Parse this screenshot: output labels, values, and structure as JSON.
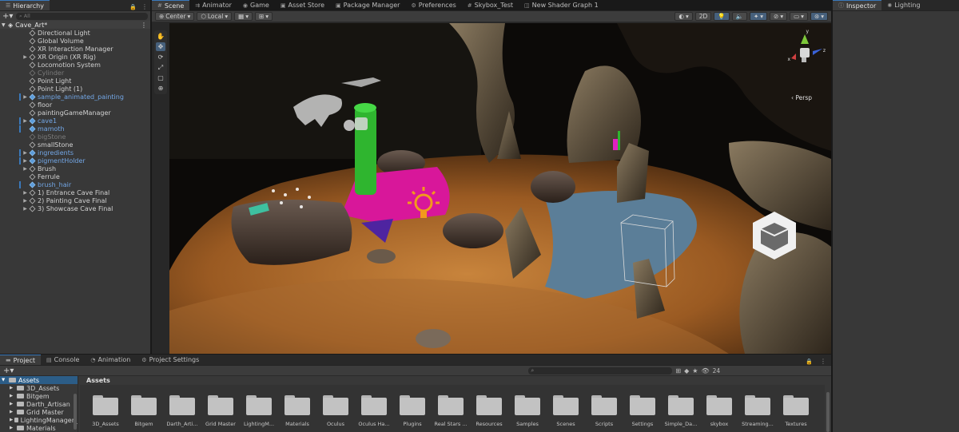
{
  "hierarchy": {
    "tab_label": "Hierarchy",
    "search_placeholder": "All",
    "scene_name": "Cave_Art*",
    "items": [
      {
        "label": "Directional Light",
        "indent": 1,
        "style": "normal",
        "arrow": false
      },
      {
        "label": "Global Volume",
        "indent": 1,
        "style": "normal",
        "arrow": false
      },
      {
        "label": "XR Interaction Manager",
        "indent": 1,
        "style": "normal",
        "arrow": false
      },
      {
        "label": "XR Origin (XR Rig)",
        "indent": 1,
        "style": "normal",
        "arrow": true
      },
      {
        "label": "Locomotion System",
        "indent": 1,
        "style": "normal",
        "arrow": false
      },
      {
        "label": "Cylinder",
        "indent": 1,
        "style": "gray",
        "arrow": false
      },
      {
        "label": "Point Light",
        "indent": 1,
        "style": "normal",
        "arrow": false
      },
      {
        "label": "Point Light (1)",
        "indent": 1,
        "style": "normal",
        "arrow": false
      },
      {
        "label": "sample_animated_painting",
        "indent": 1,
        "style": "blue",
        "arrow": true,
        "mark": true
      },
      {
        "label": "floor",
        "indent": 1,
        "style": "normal",
        "arrow": false
      },
      {
        "label": "paintingGameManager",
        "indent": 1,
        "style": "normal",
        "arrow": false
      },
      {
        "label": "cave1",
        "indent": 1,
        "style": "blue-dim",
        "arrow": true,
        "mark": true
      },
      {
        "label": "mamoth",
        "indent": 1,
        "style": "blue",
        "arrow": false,
        "mark": true
      },
      {
        "label": "bigStone",
        "indent": 1,
        "style": "gray",
        "arrow": false
      },
      {
        "label": "smallStone",
        "indent": 1,
        "style": "normal",
        "arrow": false
      },
      {
        "label": "ingredients",
        "indent": 1,
        "style": "blue",
        "arrow": true,
        "mark": true
      },
      {
        "label": "pigmentHolder",
        "indent": 1,
        "style": "blue",
        "arrow": true,
        "mark": true
      },
      {
        "label": "Brush",
        "indent": 1,
        "style": "normal",
        "arrow": true
      },
      {
        "label": "Ferrule",
        "indent": 1,
        "style": "normal",
        "arrow": false
      },
      {
        "label": "brush_hair",
        "indent": 1,
        "style": "blue",
        "arrow": false,
        "mark": true
      },
      {
        "label": "1) Entrance Cave Final",
        "indent": 1,
        "style": "normal",
        "arrow": true
      },
      {
        "label": "2) Painting Cave Final",
        "indent": 1,
        "style": "normal",
        "arrow": true
      },
      {
        "label": "3) Showcase Cave Final",
        "indent": 1,
        "style": "normal",
        "arrow": true
      }
    ]
  },
  "tabs": [
    {
      "label": "Scene",
      "icon": "scene-icon",
      "active": true
    },
    {
      "label": "Animator",
      "icon": "animator-icon",
      "active": false
    },
    {
      "label": "Game",
      "icon": "game-icon",
      "active": false
    },
    {
      "label": "Asset Store",
      "icon": "asset-store-icon",
      "active": false
    },
    {
      "label": "Package Manager",
      "icon": "package-icon",
      "active": false
    },
    {
      "label": "Preferences",
      "icon": "gear-icon",
      "active": false
    },
    {
      "label": "Skybox_Test",
      "icon": "scene-icon",
      "active": false
    },
    {
      "label": "New Shader Graph 1",
      "icon": "shader-icon",
      "active": false
    }
  ],
  "scene_toolbar": {
    "pivot": "Center",
    "space": "Local",
    "mode_2d": "2D"
  },
  "scene": {
    "camera_mode": "Persp",
    "gizmo_axes": {
      "y": "y",
      "x": "x",
      "z": "z"
    }
  },
  "inspector": {
    "tabs": [
      {
        "label": "Inspector",
        "active": true
      },
      {
        "label": "Lighting",
        "active": false
      }
    ]
  },
  "project": {
    "tabs": [
      {
        "label": "Project",
        "active": true
      },
      {
        "label": "Console",
        "active": false
      },
      {
        "label": "Animation",
        "active": false
      },
      {
        "label": "Project Settings",
        "active": false
      }
    ],
    "tree": [
      {
        "label": "Assets",
        "selected": true,
        "level": 0
      },
      {
        "label": "3D_Assets",
        "selected": false,
        "level": 1
      },
      {
        "label": "Bitgem",
        "selected": false,
        "level": 1
      },
      {
        "label": "Darth_Artisan",
        "selected": false,
        "level": 1
      },
      {
        "label": "Grid Master",
        "selected": false,
        "level": 1
      },
      {
        "label": "LightingManager_",
        "selected": false,
        "level": 1
      },
      {
        "label": "Materials",
        "selected": false,
        "level": 1
      }
    ],
    "breadcrumb": "Assets",
    "visible_count": "24",
    "folders": [
      "3D_Assets",
      "Bitgem",
      "Darth_Arti...",
      "Grid Master",
      "LightingM...",
      "Materials",
      "Oculus",
      "Oculus Ha...",
      "Plugins",
      "Real Stars ...",
      "Resources",
      "Samples",
      "Scenes",
      "Scripts",
      "Settings",
      "Simple_Da...",
      "skybox",
      "Streaming...",
      "Textures"
    ]
  }
}
